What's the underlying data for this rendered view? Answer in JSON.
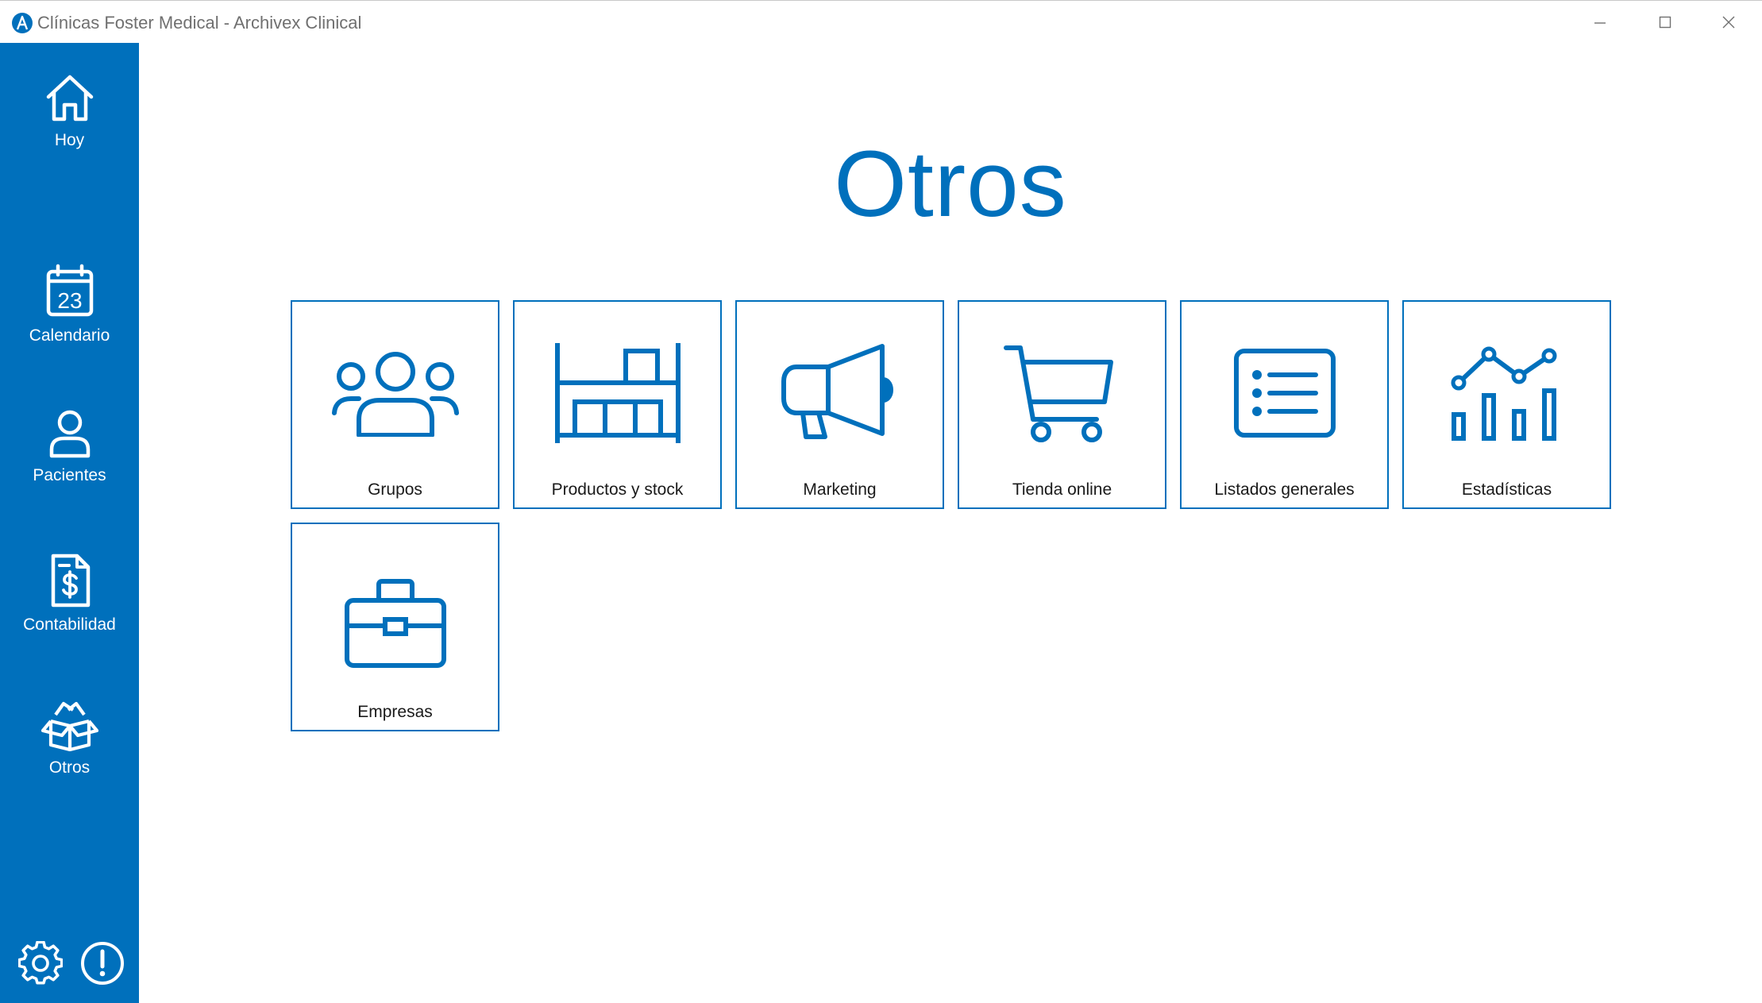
{
  "window": {
    "title": "Clínicas Foster Medical - Archivex Clinical",
    "logo_icon": "archivex-logo-icon",
    "controls": [
      "minimize-icon",
      "maximize-icon",
      "close-icon"
    ]
  },
  "colors": {
    "accent": "#0070bc",
    "sidebar_text": "#ffffff",
    "tile_text": "#1a1a1a",
    "title_text": "#707070"
  },
  "sidebar": {
    "items": [
      {
        "label": "Hoy",
        "icon": "home-icon"
      },
      {
        "label": "Calendario",
        "icon": "calendar-icon",
        "icon_text": "23"
      },
      {
        "label": "Pacientes",
        "icon": "person-icon"
      },
      {
        "label": "Contabilidad",
        "icon": "invoice-dollar-icon"
      },
      {
        "label": "Otros",
        "icon": "open-box-icon"
      }
    ],
    "bottom": [
      {
        "icon": "gear-icon"
      },
      {
        "icon": "alert-icon"
      }
    ]
  },
  "main": {
    "title": "Otros",
    "tiles": [
      {
        "label": "Grupos",
        "icon": "people-group-icon"
      },
      {
        "label": "Productos y stock",
        "icon": "shelf-boxes-icon"
      },
      {
        "label": "Marketing",
        "icon": "megaphone-icon"
      },
      {
        "label": "Tienda online",
        "icon": "shopping-cart-icon"
      },
      {
        "label": "Listados generales",
        "icon": "list-icon"
      },
      {
        "label": "Estadísticas",
        "icon": "chart-bars-line-icon"
      },
      {
        "label": "Empresas",
        "icon": "briefcase-icon"
      }
    ]
  }
}
